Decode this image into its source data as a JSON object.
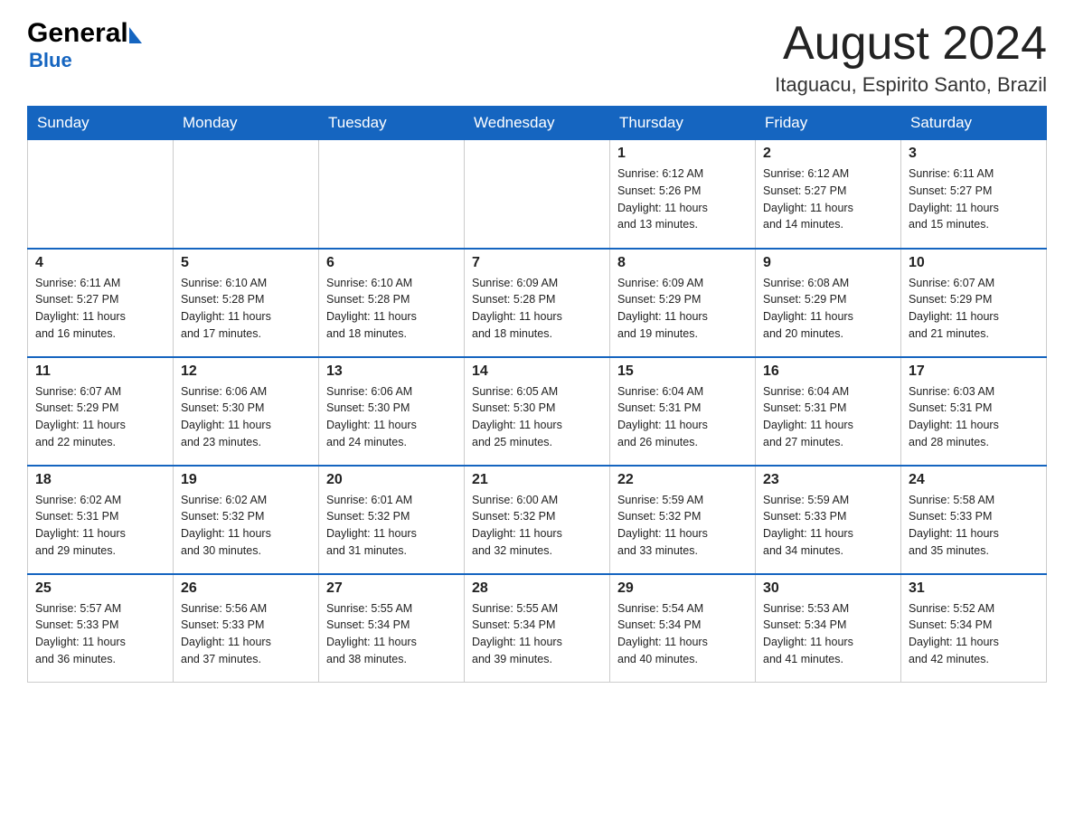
{
  "header": {
    "logo_general": "General",
    "logo_blue": "Blue",
    "month_title": "August 2024",
    "location": "Itaguacu, Espirito Santo, Brazil"
  },
  "days_of_week": [
    "Sunday",
    "Monday",
    "Tuesday",
    "Wednesday",
    "Thursday",
    "Friday",
    "Saturday"
  ],
  "weeks": [
    [
      {
        "day": "",
        "info": ""
      },
      {
        "day": "",
        "info": ""
      },
      {
        "day": "",
        "info": ""
      },
      {
        "day": "",
        "info": ""
      },
      {
        "day": "1",
        "info": "Sunrise: 6:12 AM\nSunset: 5:26 PM\nDaylight: 11 hours\nand 13 minutes."
      },
      {
        "day": "2",
        "info": "Sunrise: 6:12 AM\nSunset: 5:27 PM\nDaylight: 11 hours\nand 14 minutes."
      },
      {
        "day": "3",
        "info": "Sunrise: 6:11 AM\nSunset: 5:27 PM\nDaylight: 11 hours\nand 15 minutes."
      }
    ],
    [
      {
        "day": "4",
        "info": "Sunrise: 6:11 AM\nSunset: 5:27 PM\nDaylight: 11 hours\nand 16 minutes."
      },
      {
        "day": "5",
        "info": "Sunrise: 6:10 AM\nSunset: 5:28 PM\nDaylight: 11 hours\nand 17 minutes."
      },
      {
        "day": "6",
        "info": "Sunrise: 6:10 AM\nSunset: 5:28 PM\nDaylight: 11 hours\nand 18 minutes."
      },
      {
        "day": "7",
        "info": "Sunrise: 6:09 AM\nSunset: 5:28 PM\nDaylight: 11 hours\nand 18 minutes."
      },
      {
        "day": "8",
        "info": "Sunrise: 6:09 AM\nSunset: 5:29 PM\nDaylight: 11 hours\nand 19 minutes."
      },
      {
        "day": "9",
        "info": "Sunrise: 6:08 AM\nSunset: 5:29 PM\nDaylight: 11 hours\nand 20 minutes."
      },
      {
        "day": "10",
        "info": "Sunrise: 6:07 AM\nSunset: 5:29 PM\nDaylight: 11 hours\nand 21 minutes."
      }
    ],
    [
      {
        "day": "11",
        "info": "Sunrise: 6:07 AM\nSunset: 5:29 PM\nDaylight: 11 hours\nand 22 minutes."
      },
      {
        "day": "12",
        "info": "Sunrise: 6:06 AM\nSunset: 5:30 PM\nDaylight: 11 hours\nand 23 minutes."
      },
      {
        "day": "13",
        "info": "Sunrise: 6:06 AM\nSunset: 5:30 PM\nDaylight: 11 hours\nand 24 minutes."
      },
      {
        "day": "14",
        "info": "Sunrise: 6:05 AM\nSunset: 5:30 PM\nDaylight: 11 hours\nand 25 minutes."
      },
      {
        "day": "15",
        "info": "Sunrise: 6:04 AM\nSunset: 5:31 PM\nDaylight: 11 hours\nand 26 minutes."
      },
      {
        "day": "16",
        "info": "Sunrise: 6:04 AM\nSunset: 5:31 PM\nDaylight: 11 hours\nand 27 minutes."
      },
      {
        "day": "17",
        "info": "Sunrise: 6:03 AM\nSunset: 5:31 PM\nDaylight: 11 hours\nand 28 minutes."
      }
    ],
    [
      {
        "day": "18",
        "info": "Sunrise: 6:02 AM\nSunset: 5:31 PM\nDaylight: 11 hours\nand 29 minutes."
      },
      {
        "day": "19",
        "info": "Sunrise: 6:02 AM\nSunset: 5:32 PM\nDaylight: 11 hours\nand 30 minutes."
      },
      {
        "day": "20",
        "info": "Sunrise: 6:01 AM\nSunset: 5:32 PM\nDaylight: 11 hours\nand 31 minutes."
      },
      {
        "day": "21",
        "info": "Sunrise: 6:00 AM\nSunset: 5:32 PM\nDaylight: 11 hours\nand 32 minutes."
      },
      {
        "day": "22",
        "info": "Sunrise: 5:59 AM\nSunset: 5:32 PM\nDaylight: 11 hours\nand 33 minutes."
      },
      {
        "day": "23",
        "info": "Sunrise: 5:59 AM\nSunset: 5:33 PM\nDaylight: 11 hours\nand 34 minutes."
      },
      {
        "day": "24",
        "info": "Sunrise: 5:58 AM\nSunset: 5:33 PM\nDaylight: 11 hours\nand 35 minutes."
      }
    ],
    [
      {
        "day": "25",
        "info": "Sunrise: 5:57 AM\nSunset: 5:33 PM\nDaylight: 11 hours\nand 36 minutes."
      },
      {
        "day": "26",
        "info": "Sunrise: 5:56 AM\nSunset: 5:33 PM\nDaylight: 11 hours\nand 37 minutes."
      },
      {
        "day": "27",
        "info": "Sunrise: 5:55 AM\nSunset: 5:34 PM\nDaylight: 11 hours\nand 38 minutes."
      },
      {
        "day": "28",
        "info": "Sunrise: 5:55 AM\nSunset: 5:34 PM\nDaylight: 11 hours\nand 39 minutes."
      },
      {
        "day": "29",
        "info": "Sunrise: 5:54 AM\nSunset: 5:34 PM\nDaylight: 11 hours\nand 40 minutes."
      },
      {
        "day": "30",
        "info": "Sunrise: 5:53 AM\nSunset: 5:34 PM\nDaylight: 11 hours\nand 41 minutes."
      },
      {
        "day": "31",
        "info": "Sunrise: 5:52 AM\nSunset: 5:34 PM\nDaylight: 11 hours\nand 42 minutes."
      }
    ]
  ]
}
